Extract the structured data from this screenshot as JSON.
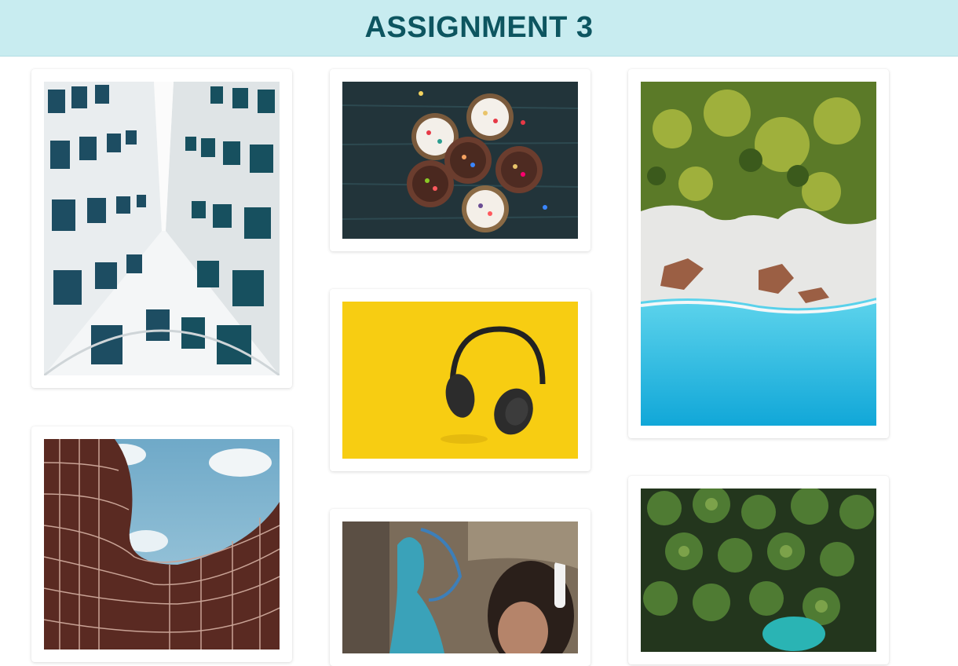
{
  "header": {
    "title": "ASSIGNMENT 3"
  },
  "gallery": {
    "images": [
      {
        "subject": "white-building-looking-up"
      },
      {
        "subject": "cupcakes-on-dark-table"
      },
      {
        "subject": "aerial-beach-palms-sea"
      },
      {
        "subject": "yellow-background-headphones"
      },
      {
        "subject": "wavy-red-building-sky"
      },
      {
        "subject": "street-art-wall-person"
      },
      {
        "subject": "aerial-palm-forest"
      }
    ]
  },
  "colors": {
    "header_bg": "#c8ecf0",
    "title_color": "#0d5560"
  }
}
